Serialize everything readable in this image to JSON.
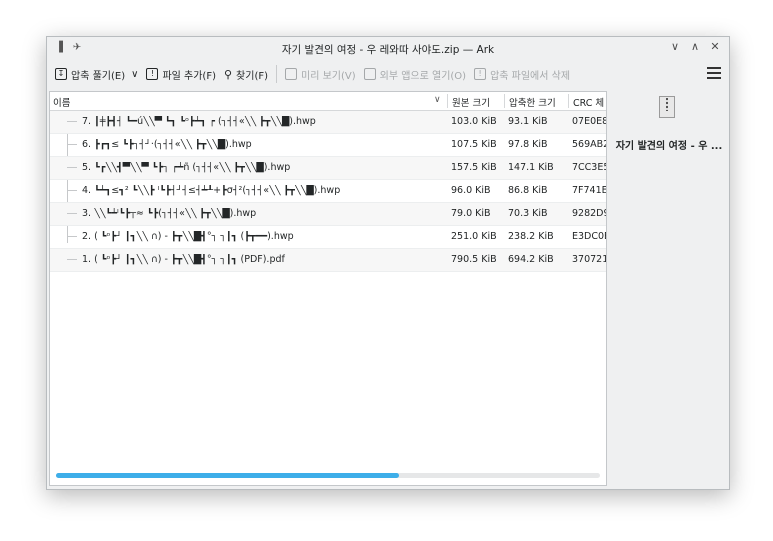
{
  "window": {
    "title": "자기 발견의 여정 - 우 레와따 사야도.zip — Ark"
  },
  "titlebar_buttons": {
    "minimize": "∨",
    "maximize": "∧",
    "close": "✕"
  },
  "toolbar": {
    "extract": "압축 풀기(E)",
    "extract_arrow": "∨",
    "add_file": "파일 추가(F)",
    "find": "찾기(F)",
    "preview": "미리 보기(V)",
    "open_external": "외부 앱으로 열기(O)",
    "delete": "압축 파일에서 삭제"
  },
  "columns": {
    "name": "이름",
    "original_size": "원본 크기",
    "compressed_size": "압축한 크기",
    "crc": "CRC 체"
  },
  "files": [
    {
      "name": "7. ┃╪┣┫┤ ┗━ú╲╲▀ ┗┓ ┗ᵒ┣┷┓ ┍ (┐┤┤«╲╲ ┣┳╲╲█).hwp",
      "original": "103.0 KiB",
      "compressed": "93.1 KiB",
      "crc": "07E0E8"
    },
    {
      "name": "6. ┣┏┓≤ ┗┣┐┤┘·(┐┤┤«╲╲ ┣┳╲╲█).hwp",
      "original": "107.5 KiB",
      "compressed": "97.8 KiB",
      "crc": "569AB2"
    },
    {
      "name": "5. ┗┏╲╲┫▀╲╲▀ ┗┣┐ ┍┷ñ (┐┤┤«╲╲ ┣┳╲╲█).hwp",
      "original": "157.5 KiB",
      "compressed": "147.1 KiB",
      "crc": "7CC3E5"
    },
    {
      "name": "4. ┗┷┓≤┓² ┗╲╲┣ ᴵ┗┣┤┘┤≤┤┷┸+┣σ┤²(┐┤┤«╲╲ ┣┳╲╲█).hwp",
      "original": "96.0 KiB",
      "compressed": "86.8 KiB",
      "crc": "7F741E"
    },
    {
      "name": "3. ╲╲┗┷ᴵ┗┣┬≈ ┗┣(┐┤┤«╲╲ ┣┳╲╲█).hwp",
      "original": "79.0 KiB",
      "compressed": "70.3 KiB",
      "crc": "9282D9"
    },
    {
      "name": "2. ( ┗ᵒ┣┘ ┃┓╲╲ ∩) - ┣┳╲╲█┫°┐ ┐┃┓ (┣┳━━).hwp",
      "original": "251.0 KiB",
      "compressed": "238.2 KiB",
      "crc": "E3DC0E"
    },
    {
      "name": "1. ( ┗ᵒ┣┘ ┃┓╲╲ ∩) - ┣┳╲╲█┫°┐ ┐┃┓ (PDF).pdf",
      "original": "790.5 KiB",
      "compressed": "694.2 KiB",
      "crc": "370721"
    }
  ],
  "side": {
    "title": "자기 발견의 여정 - 우 ..."
  },
  "scroll": {
    "horizontal_position": 0.63
  },
  "colors": {
    "accent": "#3daee9"
  }
}
